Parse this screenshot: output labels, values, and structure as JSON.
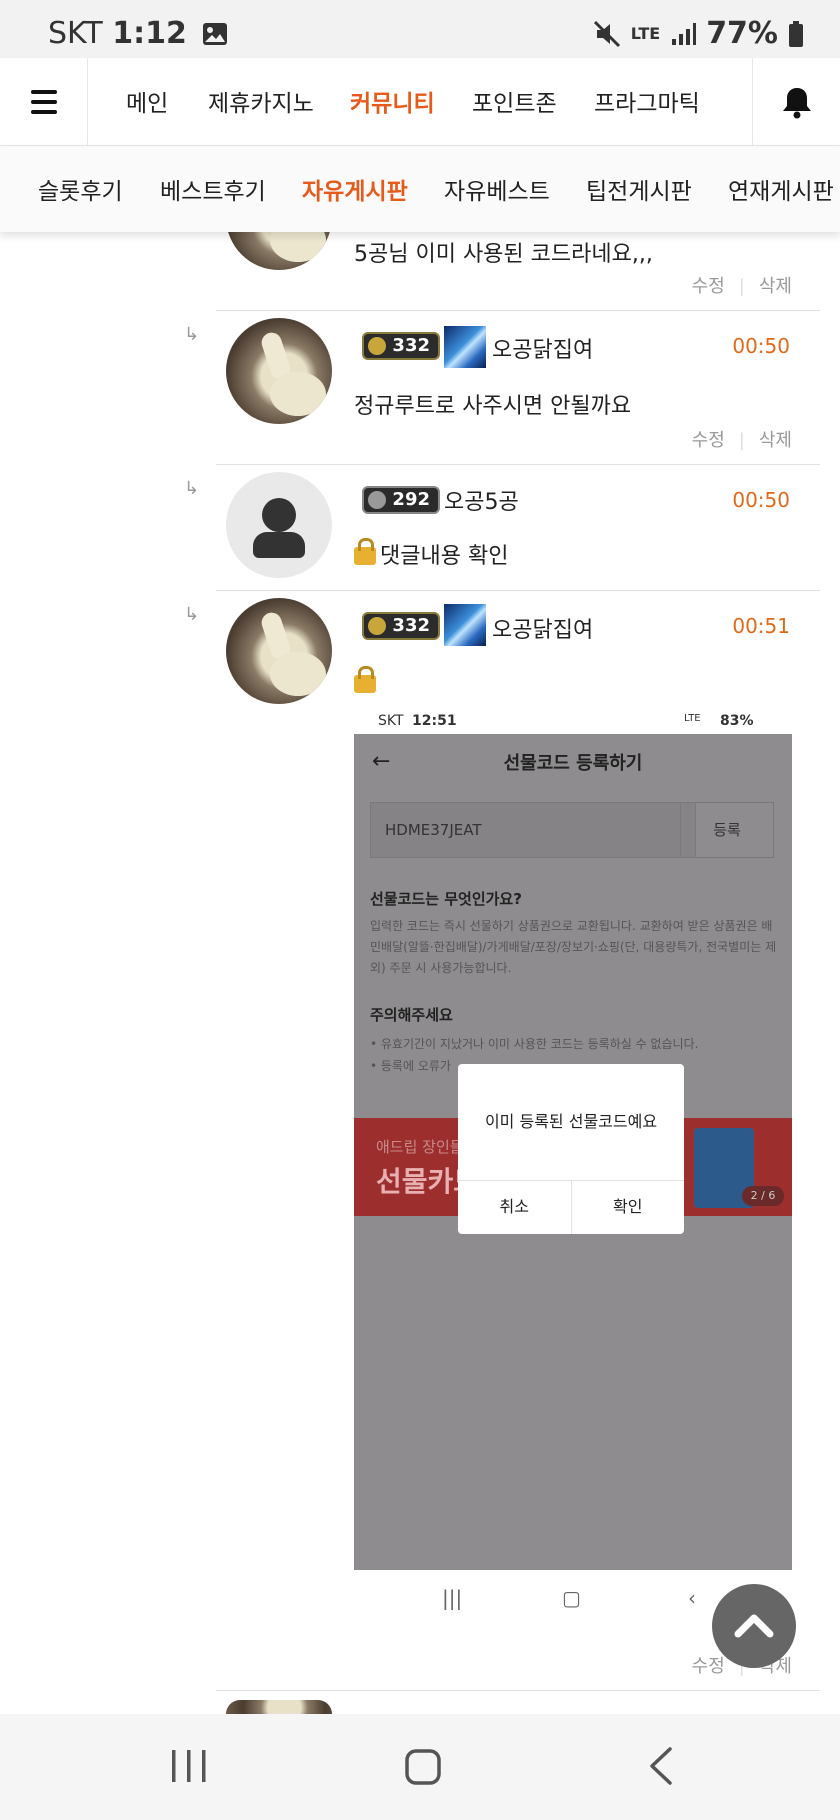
{
  "status_bar": {
    "carrier": "SKT",
    "time": "1:12",
    "network": "LTE",
    "battery": "77%"
  },
  "top_nav": {
    "items": [
      {
        "label": "메인",
        "active": false
      },
      {
        "label": "제휴카지노",
        "active": false
      },
      {
        "label": "커뮤니티",
        "active": true
      },
      {
        "label": "포인트존",
        "active": false
      },
      {
        "label": "프라그마틱",
        "active": false
      }
    ]
  },
  "sub_nav": {
    "items": [
      {
        "label": "슬롯후기",
        "active": false
      },
      {
        "label": "베스트후기",
        "active": false
      },
      {
        "label": "자유게시판",
        "active": true
      },
      {
        "label": "자유베스트",
        "active": false
      },
      {
        "label": "팁전게시판",
        "active": false
      },
      {
        "label": "연재게시판",
        "active": false
      }
    ]
  },
  "comments": [
    {
      "text": "5공님 이미 사용된 코드라네요,,,",
      "edit": "수정",
      "delete": "삭제"
    },
    {
      "level": "332",
      "nickname": "오공닭집여",
      "time": "00:50",
      "text": "정규루트로 사주시면 안될까요",
      "edit": "수정",
      "delete": "삭제"
    },
    {
      "level": "292",
      "nickname": "오공5공",
      "time": "00:50",
      "text": "댓글내용 확인"
    },
    {
      "level": "332",
      "nickname": "오공닭집여",
      "time": "00:51",
      "edit": "수정",
      "delete": "삭제"
    }
  ],
  "embedded_screenshot": {
    "status": {
      "carrier": "SKT",
      "time": "12:51",
      "network": "LTE",
      "battery": "83%"
    },
    "title": "선물코드 등록하기",
    "code_value": "HDME37JEAT",
    "register_button": "등록",
    "what_heading": "선물코드는 무엇인가요?",
    "what_body": "입력한 코드는 즉시 선물하기 상품권으로 교환됩니다. 교환하여 받은 상품권은 배민배달(알뜰·한집배달)/가게배달/포장/장보기·쇼핑(단, 대용량특가, 전국별미는 제외) 주문 시 사용가능합니다.",
    "caution_heading": "주의해주세요",
    "caution_items": [
      "• 유효기간이 지났거나 이미 사용한 코드는 등록하실 수 없습니다.",
      "• 등록에 오류가"
    ],
    "banner_small": "애드립 장인들",
    "banner_big": "선물카드",
    "banner_pager": "2 / 6",
    "dialog": {
      "message": "이미 등록된 선물코드예요",
      "cancel": "취소",
      "confirm": "확인"
    }
  },
  "colors": {
    "accent": "#e85a1a",
    "time": "#e06a1a"
  },
  "icons": {
    "menu": "hamburger-icon",
    "bell": "bell-icon",
    "scroll_top": "chevron-up-icon"
  }
}
